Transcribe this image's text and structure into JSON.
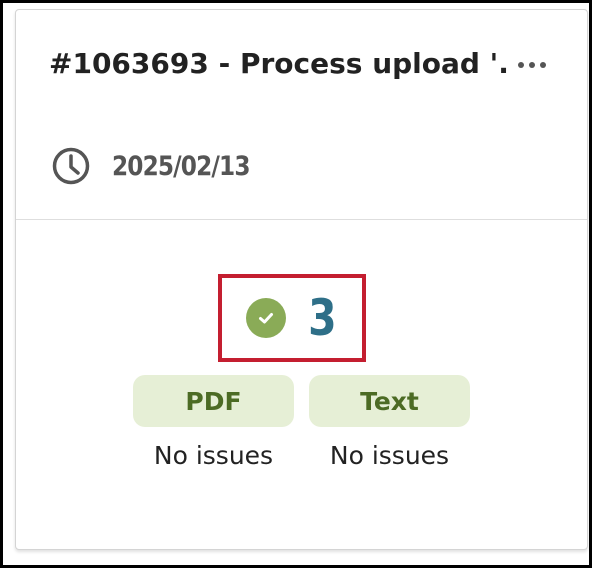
{
  "card": {
    "title": "#1063693 - Process upload '...",
    "more_icon": "more-horizontal-icon",
    "date": "2025/02/13",
    "date_icon": "clock-icon"
  },
  "summary": {
    "status_icon": "check-circle-icon",
    "count": "3"
  },
  "checks": [
    {
      "label": "PDF",
      "status": "No issues"
    },
    {
      "label": "Text",
      "status": "No issues"
    }
  ],
  "colors": {
    "success_green": "#8aab57",
    "count_blue": "#2e6f88",
    "badge_bg": "#e6efd6",
    "badge_text": "#4c6b24",
    "highlight_red": "#c41e30"
  }
}
